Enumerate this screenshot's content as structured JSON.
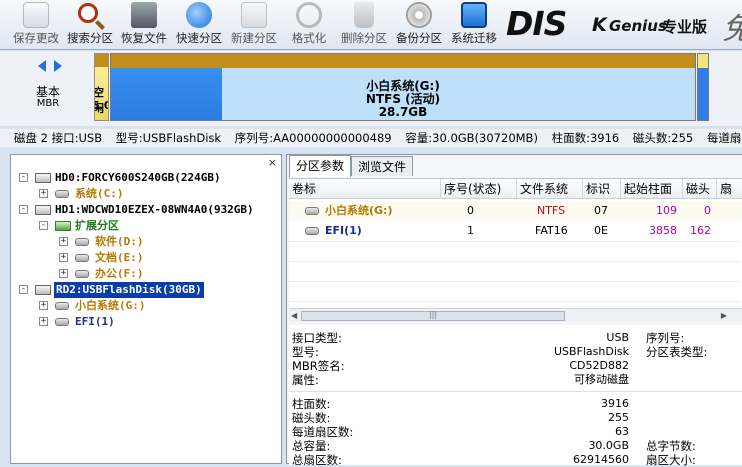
{
  "toolbar": {
    "buttons": [
      {
        "label": "保存更改",
        "icon": "save-icon",
        "enabled": false
      },
      {
        "label": "搜索分区",
        "icon": "search-icon",
        "enabled": true
      },
      {
        "label": "恢复文件",
        "icon": "restore-icon",
        "enabled": true
      },
      {
        "label": "快速分区",
        "icon": "quick-partition-icon",
        "enabled": true
      },
      {
        "label": "新建分区",
        "icon": "new-partition-icon",
        "enabled": false
      },
      {
        "label": "格式化",
        "icon": "format-icon",
        "enabled": false
      },
      {
        "label": "删除分区",
        "icon": "delete-icon",
        "enabled": false
      },
      {
        "label": "备份分区",
        "icon": "backup-icon",
        "enabled": true
      },
      {
        "label": "系统迁移",
        "icon": "migrate-icon",
        "enabled": true
      }
    ],
    "logo": {
      "dis": "DIS",
      "k": "K",
      "genius": "Genius",
      "edition": "专业版",
      "deco": "免"
    }
  },
  "disk_map": {
    "type": "基本",
    "style": "MBR",
    "small_part_text1": "空闲",
    "small_part_text2": "5.0",
    "main_partition": {
      "name": "小白系统(G:)",
      "fs": "NTFS (活动)",
      "size": "28.7GB",
      "used_fraction": 0.19
    }
  },
  "disk_info": {
    "disk": "磁盘 2 接口:USB",
    "model": "型号:USBFlashDisk",
    "serial": "序列号:AA00000000000489",
    "capacity": "容量:30.0GB(30720MB)",
    "cylinders": "柱面数:3916",
    "heads": "磁头数:255",
    "sectors": "每道扇区数:"
  },
  "tree": {
    "items": [
      {
        "label": "HD0:FORCY600S240GB(224GB)"
      },
      {
        "label": "系统(C:)"
      },
      {
        "label": "HD1:WDCWD10EZEX-08WN4A0(932GB)"
      },
      {
        "label": "扩展分区"
      },
      {
        "label": "软件(D:)"
      },
      {
        "label": "文档(E:)"
      },
      {
        "label": "办公(F:)"
      },
      {
        "label": "RD2:USBFlashDisk(30GB)"
      },
      {
        "label": "小白系统(G:)"
      },
      {
        "label": "EFI(1)"
      }
    ],
    "close": "×"
  },
  "tabs": [
    {
      "label": "分区参数"
    },
    {
      "label": "浏览文件"
    }
  ],
  "grid": {
    "columns": [
      "卷标",
      "序号(状态)",
      "文件系统",
      "标识",
      "起始柱面",
      "磁头",
      "扇"
    ],
    "rows": [
      {
        "label": "小白系统(G:)",
        "index": "0",
        "fs": "NTFS",
        "id": "07",
        "start_cyl": "109",
        "head": "0"
      },
      {
        "label": "EFI(1)",
        "index": "1",
        "fs": "FAT16",
        "id": "0E",
        "start_cyl": "3858",
        "head": "162"
      }
    ]
  },
  "details": {
    "interface_label": "接口类型:",
    "interface_value": "USB",
    "serial_label": "序列号:",
    "model_label": "型号:",
    "model_value": "USBFlashDisk",
    "pt_label": "分区表类型:",
    "mbr_sig_label": "MBR签名:",
    "mbr_sig_value": "CD52D882",
    "attr_label": "属性:",
    "attr_value": "可移动磁盘",
    "cyl_label": "柱面数:",
    "cyl_value": "3916",
    "heads_label": "磁头数:",
    "heads_value": "255",
    "spt_label": "每道扇区数:",
    "spt_value": "63",
    "cap_label": "总容量:",
    "cap_value": "30.0GB",
    "bytes_label": "总字节数:",
    "sectors_label": "总扇区数:",
    "sectors_value": "62914560",
    "sector_size_label": "扇区大小:"
  }
}
